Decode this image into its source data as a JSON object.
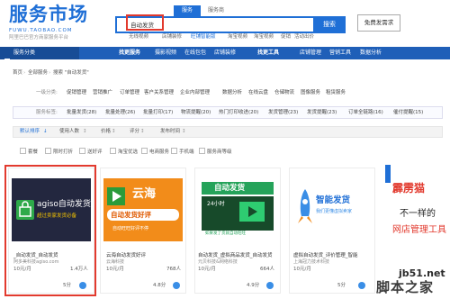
{
  "logo": {
    "title": "服务市场",
    "sub": "FUWU.TAOBAO.COM",
    "slogan": "阿里巴巴官方商家服务平台"
  },
  "search": {
    "tabs": [
      "服务",
      "服务商"
    ],
    "query": "自动发货",
    "search_label": "搜索",
    "publish_label": "免费发需求",
    "hot_keywords": [
      "无线视频",
      "店铺装修",
      "旺铺智能版",
      "淘宝视频",
      "淘宝视频",
      "促销",
      "活动出价"
    ]
  },
  "nav": {
    "service_category": "服务分类",
    "items": [
      "找更服务",
      "摄影视频",
      "在线包包",
      "店铺装修",
      "找更工具",
      "店铺管理",
      "营销工具",
      "数据分析"
    ]
  },
  "breadcrumb": [
    "首页",
    "全部服务",
    "搜索 \"自动发货\""
  ],
  "categories": {
    "row1_label": "一级分类:",
    "row1": [
      "促销管理",
      "营销推广",
      "订单管理",
      "客户关系管理",
      "企业内部管理",
      "数据分析",
      "在线云盘",
      "仓储物流",
      "图像服务",
      "租赁服务"
    ],
    "row2_label": "服务标签:",
    "row2": [
      "批量发货(28)",
      "批量处理(26)",
      "批量打印(17)",
      "物流提醒(20)",
      "热门打印收进(20)",
      "发货管理(23)",
      "发货提醒(23)",
      "订单全链路(16)",
      "催付提醒(15)"
    ]
  },
  "sort": [
    "默认排序",
    "使用人数",
    "价格",
    "评分",
    "发布时间"
  ],
  "checkboxes": [
    "套餐",
    "限时打折",
    "送好评",
    "淘宝优选",
    "电商服务",
    "手机端",
    "服务商等级"
  ],
  "cards": [
    {
      "title": "_自动发货_自动发货",
      "vendor": "阿多美科技agiso.com",
      "price": "10元/月",
      "sold": "1.4万人",
      "score": "5分",
      "banner_line1": "agiso自动发货",
      "banner_line2": "超过卖家发货必备"
    },
    {
      "title": "云海自动发货好评",
      "vendor": "云海科技",
      "price": "10元/月",
      "sold": "768人",
      "score": "4.8分",
      "banner_line1": "云海",
      "banner_line2": "自动发货好评",
      "banner_line3": "自动旺旺好评不停"
    },
    {
      "title": "自动发货_虚拟商品发货_自动发货",
      "vendor": "元贝科技&网络科技",
      "price": "10元/月",
      "sold": "664人",
      "score": "4.9分",
      "banner_line1": "自动发货",
      "banner_line2": "24小时",
      "banner_line3": "如果发了货就自动旺旺"
    },
    {
      "title": "虚拟自动发货_评价管理_智能",
      "vendor": "上海冠力技术科技",
      "price": "10元/月",
      "sold": "",
      "score": "5分",
      "banner_line1": "智能发货",
      "banner_line2": "我们更懂虚拟卖家"
    },
    {
      "title": "",
      "vendor": "",
      "price": "",
      "sold": "",
      "score": "",
      "banner_line1": "霹雳猫",
      "banner_line2": "不一样的",
      "banner_line3": "网店管理工具"
    }
  ],
  "watermark": {
    "line1": "jb51.net",
    "line2": "脚本之家"
  },
  "colors": {
    "brand_blue": "#1f6fd6",
    "nav_blue": "#1f5fb8",
    "highlight_red": "#e23a2e",
    "card2_orange": "#f28c1a"
  }
}
